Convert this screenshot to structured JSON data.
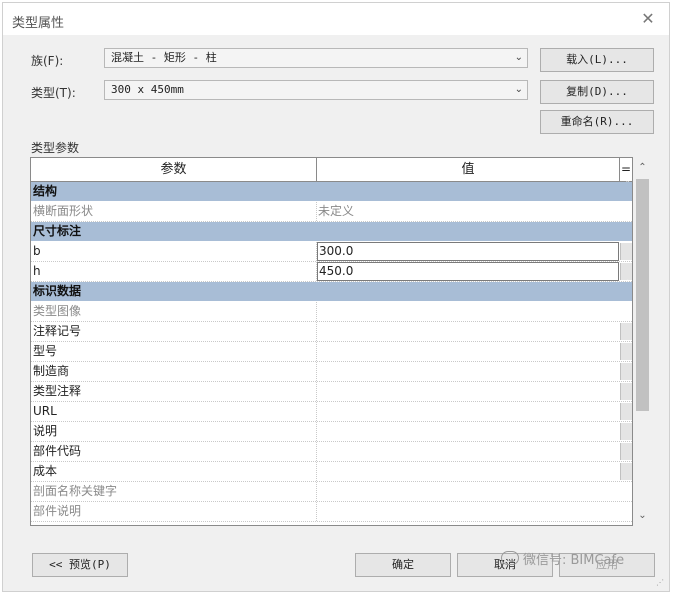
{
  "window": {
    "title": "类型属性",
    "close_glyph": "✕"
  },
  "family": {
    "label": "族(F):",
    "value": "混凝土 - 矩形 - 柱"
  },
  "type": {
    "label": "类型(T):",
    "value": "300 x 450mm"
  },
  "buttons": {
    "load": "载入(L)...",
    "duplicate": "复制(D)...",
    "rename": "重命名(R)...",
    "preview": "<< 预览(P)",
    "ok": "确定",
    "cancel": "取消",
    "apply": "应用"
  },
  "params_section_label": "类型参数",
  "table": {
    "col_param": "参数",
    "col_value": "值",
    "col_eq": "=",
    "groups": [
      {
        "name": "结构",
        "rows": [
          {
            "name": "横断面形状",
            "value": "未定义",
            "editable": false
          }
        ]
      },
      {
        "name": "尺寸标注",
        "rows": [
          {
            "name": "b",
            "value": "300.0",
            "editable": true
          },
          {
            "name": "h",
            "value": "450.0",
            "editable": true
          }
        ]
      },
      {
        "name": "标识数据",
        "rows": [
          {
            "name": "类型图像",
            "value": "",
            "editable": false
          },
          {
            "name": "注释记号",
            "value": "",
            "editable": true
          },
          {
            "name": "型号",
            "value": "",
            "editable": true
          },
          {
            "name": "制造商",
            "value": "",
            "editable": true
          },
          {
            "name": "类型注释",
            "value": "",
            "editable": true
          },
          {
            "name": "URL",
            "value": "",
            "editable": true
          },
          {
            "name": "说明",
            "value": "",
            "editable": true
          },
          {
            "name": "部件代码",
            "value": "",
            "editable": true
          },
          {
            "name": "成本",
            "value": "",
            "editable": true
          },
          {
            "name": "剖面名称关键字",
            "value": "",
            "editable": false
          },
          {
            "name": "部件说明",
            "value": "",
            "editable": false
          }
        ]
      }
    ]
  },
  "watermark": "微信号: BIMCafe",
  "colors": {
    "group_header": "#a8bdd6",
    "dialog_bg": "#f0f0f0"
  }
}
